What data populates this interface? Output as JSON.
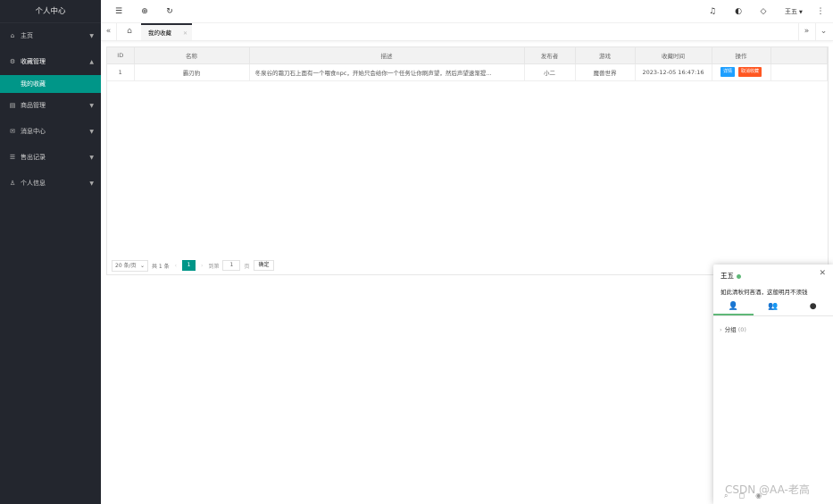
{
  "sidebar": {
    "logo": "个人中心",
    "menu": [
      {
        "label": "主页",
        "icon": "⌂"
      },
      {
        "label": "收藏管理",
        "icon": "⚙",
        "open": true,
        "children": [
          {
            "label": "我的收藏"
          }
        ]
      },
      {
        "label": "商品管理",
        "icon": "▤"
      },
      {
        "label": "消息中心",
        "icon": "✉"
      },
      {
        "label": "售出记录",
        "icon": "☰"
      },
      {
        "label": "个人信息",
        "icon": "♙"
      }
    ]
  },
  "header": {
    "user": "王五"
  },
  "tabs": {
    "items": [
      {
        "label": "我的收藏"
      }
    ]
  },
  "table": {
    "columns": [
      "ID",
      "名称",
      "描述",
      "发布者",
      "游戏",
      "收藏时间",
      "操作"
    ],
    "rows": [
      {
        "id": "1",
        "name": "霸刃豹",
        "desc": "冬泉谷的霜刀石上面有一个喂食npc，开始只会给你一个任务让你刷声望，然后声望速渐提...",
        "publisher": "小二",
        "game": "魔兽世界",
        "time": "2023-12-05 16:47:16",
        "detail": "详情",
        "cancel": "取消收藏"
      }
    ]
  },
  "pager": {
    "per_page": "20 条/页",
    "total": "共 1 条",
    "current": "1",
    "goto_label": "到第",
    "goto_value": "1",
    "page_unit": "页",
    "confirm": "确定"
  },
  "chat": {
    "name": "王五",
    "sign": "如此清秋何吝酒，这般明月不须钱",
    "group_label": "分组",
    "group_count": "(0)"
  },
  "watermark": "CSDN @AA-老高"
}
